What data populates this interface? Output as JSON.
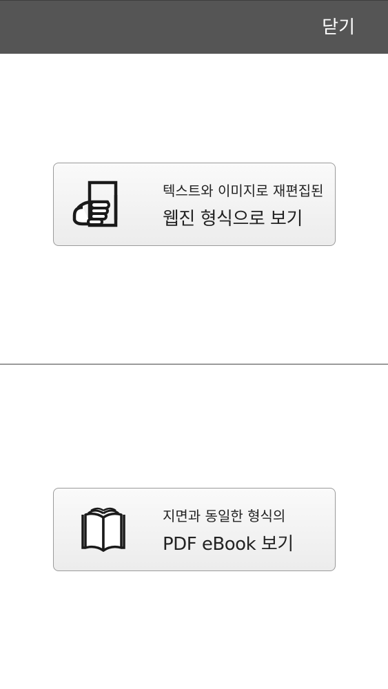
{
  "header": {
    "close_label": "닫기"
  },
  "options": [
    {
      "id": "webzine",
      "icon": "hand-document-icon",
      "line1": "텍스트와 이미지로 재편집된",
      "line2": "웹진 형식으로 보기"
    },
    {
      "id": "pdf",
      "icon": "open-book-icon",
      "line1": "지면과 동일한 형식의",
      "line2": "PDF eBook 보기"
    }
  ],
  "colors": {
    "header_bg": "#555555",
    "header_text": "#ffffff",
    "card_border": "#9a9a9a",
    "text": "#222222"
  }
}
